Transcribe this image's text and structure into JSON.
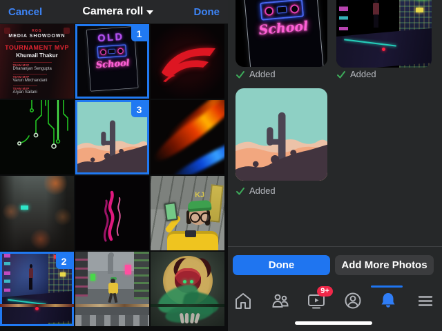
{
  "header": {
    "cancel_label": "Cancel",
    "title": "Camera roll",
    "done_label": "Done"
  },
  "camera_roll": {
    "poster": {
      "event_label": "ROG",
      "event_title": "MEDIA SHOWDOWN",
      "mvp_label": "TOURNAMENT MVP",
      "mvp_name": "Khumail Thakur",
      "entries": [
        {
          "label": "TEAM MVP",
          "name": "Dhananjan Sengupta"
        },
        {
          "label": "TEAM MVP",
          "name": "Varun Mirchandani"
        },
        {
          "label": "TEAM MVP",
          "name": "Aryan Sailani"
        }
      ]
    },
    "neon_sign": {
      "line1": "OLD",
      "line2": "School"
    },
    "killjoy_tag": "KJ",
    "selection_badges": {
      "neon": "1",
      "cactus": "3",
      "rooftop": "2"
    }
  },
  "selected": {
    "items": [
      {
        "name": "neon-old-school",
        "status": "Added"
      },
      {
        "name": "cyberpunk-rooftop",
        "status": "Added"
      },
      {
        "name": "desert-cactus",
        "status": "Added"
      }
    ]
  },
  "actions": {
    "done_label": "Done",
    "add_more_label": "Add More Photos"
  },
  "navbar": {
    "watch_badge": "9+",
    "icons": [
      "home-icon",
      "friends-icon",
      "watch-icon",
      "profile-icon",
      "notifications-icon",
      "menu-icon"
    ],
    "active_icon": "notifications-icon"
  },
  "colors": {
    "accent_blue": "#1f75f0",
    "badge_red": "#f02849",
    "check_green": "#3dab5a",
    "panel_bg": "#262829",
    "header_bg": "#27282a",
    "button_gray": "#3b3c3e",
    "icon_gray": "#b0b3b8"
  }
}
